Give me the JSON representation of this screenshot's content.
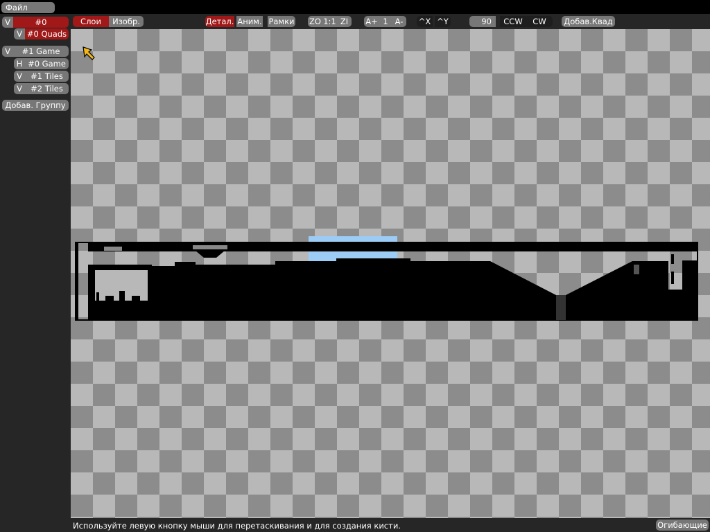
{
  "menu": {
    "file_label": "Файл"
  },
  "toolbar": {
    "mode_tabs": {
      "layers": "Слои",
      "images": "Изобр."
    },
    "detail": "Детал.",
    "anim": "Аним.",
    "frames": "Рамки",
    "zoom": {
      "out": "ZO",
      "reset": "1:1",
      "in": "ZI"
    },
    "anim_speed": {
      "inc": "A+",
      "value": "1",
      "dec": "A-"
    },
    "flip": {
      "x": "^X",
      "y": "^Y"
    },
    "rotate": {
      "angle": "90",
      "ccw": "CCW",
      "cw": "CW"
    },
    "add_quad": "Добав.Квад"
  },
  "sidebar": {
    "groups": [
      {
        "visibility": "V",
        "name": "#0",
        "selected": true,
        "layers": [
          {
            "visibility": "V",
            "name": "#0 Quads",
            "selected": true
          }
        ]
      },
      {
        "visibility": "V",
        "name": "#1 Game",
        "selected": false,
        "layers": [
          {
            "visibility": "H",
            "name": "#0 Game",
            "selected": false
          },
          {
            "visibility": "V",
            "name": "#1 Tiles",
            "selected": false
          },
          {
            "visibility": "V",
            "name": "#2 Tiles",
            "selected": false
          }
        ]
      }
    ],
    "add_group": "Добав. Группу"
  },
  "status": {
    "hint": "Используйте левую кнопку мыши для перетаскивания и для создания кисти.",
    "envelopes_button": "Огибающие"
  },
  "colors": {
    "selected": "#a01818",
    "button": "#777777",
    "panel": "#262626",
    "quad_sky": "#9ccbf5"
  }
}
